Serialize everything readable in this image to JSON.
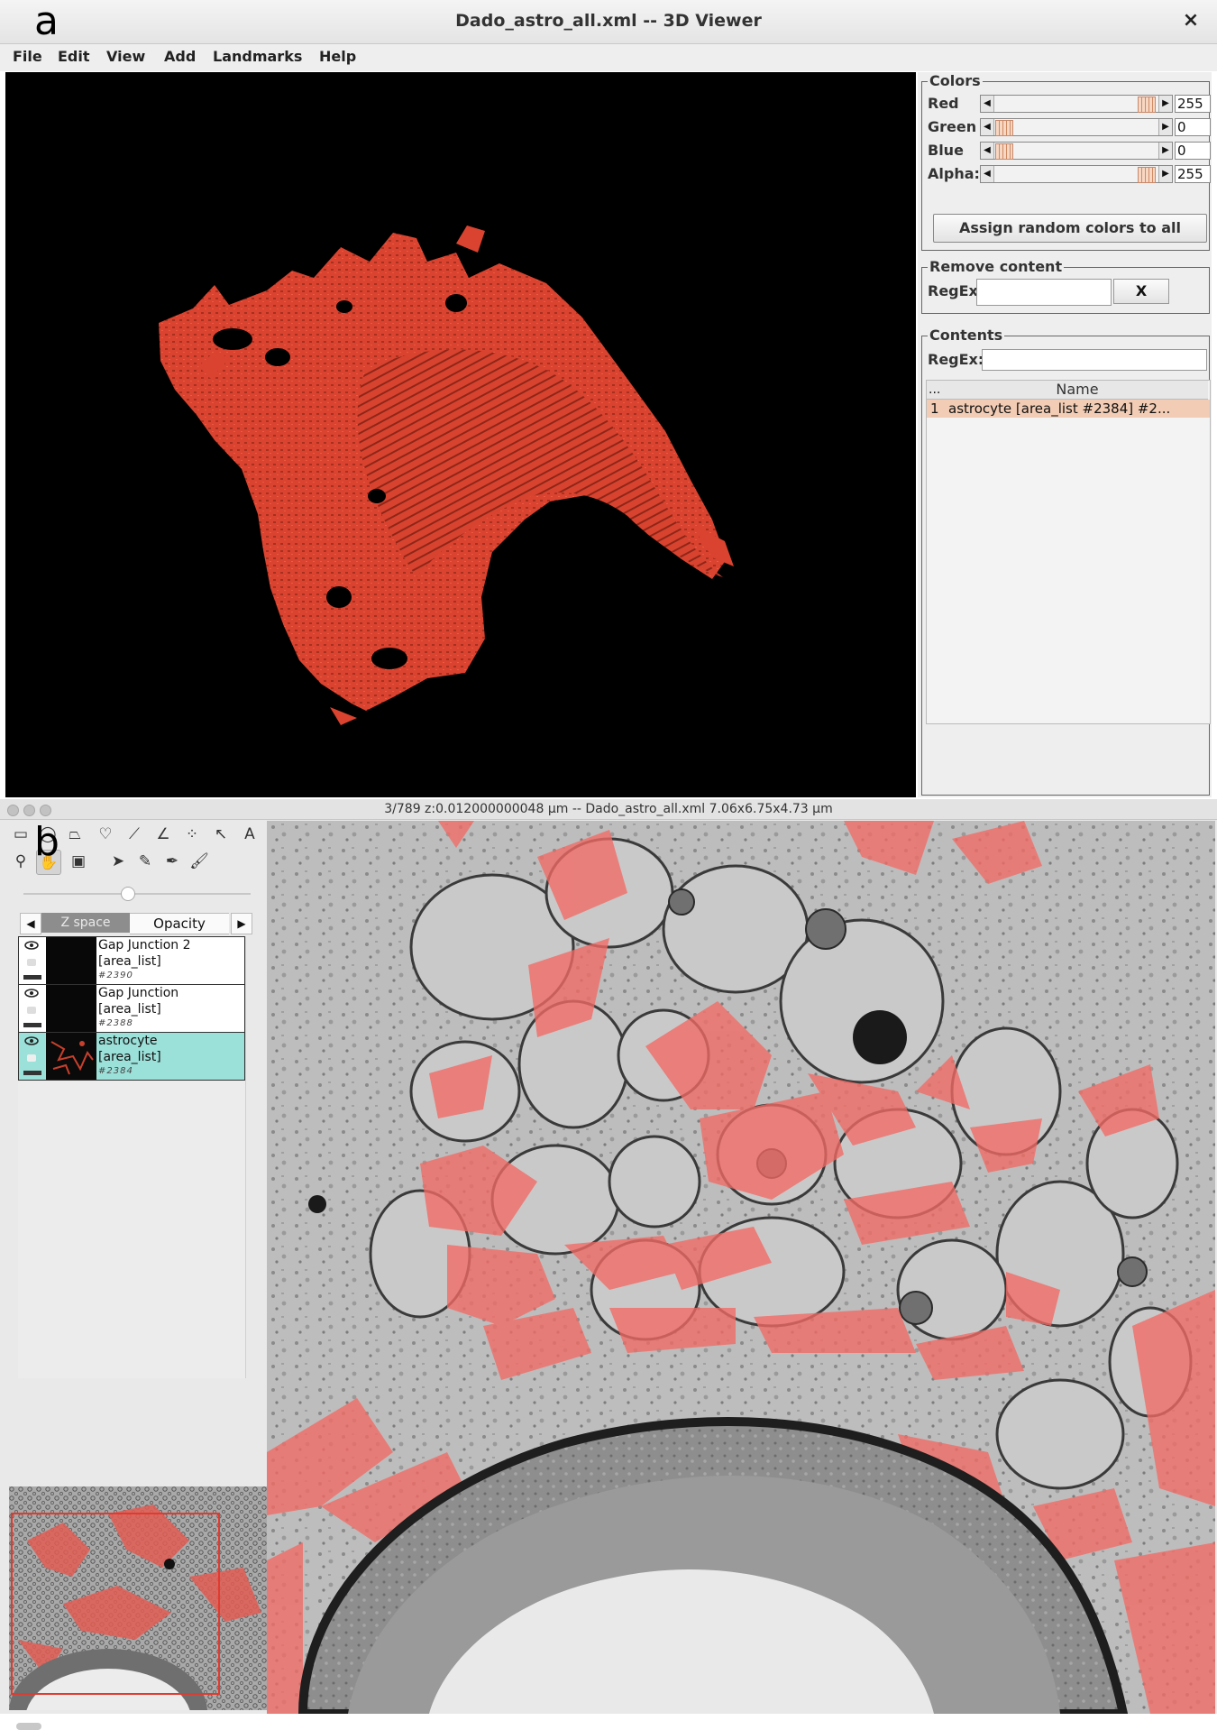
{
  "panel_labels": {
    "a": "a",
    "b": "b"
  },
  "window": {
    "title": "Dado_astro_all.xml -- 3D Viewer",
    "close_icon": "×"
  },
  "menu": [
    "File",
    "Edit",
    "View",
    "Add",
    "Landmarks",
    "Help"
  ],
  "colors_panel": {
    "title": "Colors",
    "channels": [
      {
        "label": "Red",
        "value": "255",
        "level": 1.0
      },
      {
        "label": "Green",
        "value": "0",
        "level": 0.0
      },
      {
        "label": "Blue",
        "value": "0",
        "level": 0.0
      },
      {
        "label": "Alpha:",
        "value": "255",
        "level": 1.0
      }
    ],
    "assign_button": "Assign random colors to all"
  },
  "remove_panel": {
    "title": "Remove content",
    "regex_label": "RegEx:",
    "regex_value": "",
    "remove_button": "X"
  },
  "contents_panel": {
    "title": "Contents",
    "regex_label": "RegEx:",
    "regex_value": "",
    "columns": [
      "...",
      "Name"
    ],
    "rows": [
      {
        "index": "1",
        "name": "astrocyte [area_list #2384] #2..."
      }
    ]
  },
  "status": {
    "text": "3/789  z:0.012000000048 µm   -- Dado_astro_all.xml  7.06x6.75x4.73 µm"
  },
  "tools": {
    "row1": [
      "rectangle-select-icon",
      "oval-select-icon",
      "polygon-select-icon",
      "freehand-select-icon",
      "line-tool-icon",
      "angle-tool-icon",
      "point-tool-icon",
      "wand-icon",
      "text-tool-icon"
    ],
    "row2": [
      "magnifier-icon",
      "hand-icon",
      "color-picker-icon",
      "arrow-select-icon",
      "pencil-icon",
      "pen-icon",
      "brush-icon"
    ]
  },
  "tabs": {
    "left": "◀",
    "zspace": "Z space",
    "opacity": "Opacity",
    "right": "▶"
  },
  "layers": [
    {
      "name": "Gap Junction 2",
      "type": "[area_list]",
      "id": "#2390",
      "selected": false
    },
    {
      "name": "Gap Junction",
      "type": "[area_list]",
      "id": "#2388",
      "selected": false
    },
    {
      "name": "astrocyte",
      "type": "[area_list]",
      "id": "#2384",
      "selected": true
    }
  ],
  "colors": {
    "astrocyte": "#e0402c",
    "overlay": "#f26a64",
    "selection": "#9be0d9",
    "viewer_bg": "#000000"
  }
}
